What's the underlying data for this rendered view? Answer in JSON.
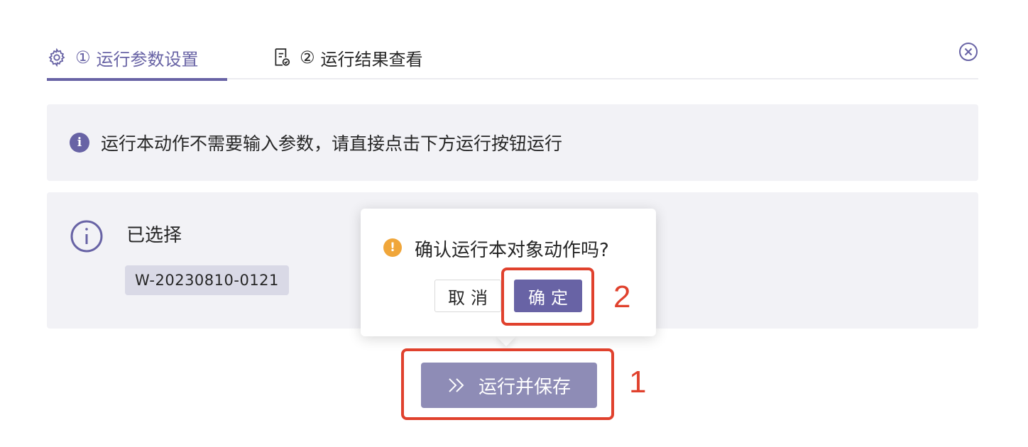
{
  "tabs": [
    {
      "step": "①",
      "label": "运行参数设置",
      "icon": "gear-icon",
      "active": true
    },
    {
      "step": "②",
      "label": "运行结果查看",
      "icon": "report-check-icon",
      "active": false
    }
  ],
  "info_banner": {
    "icon": "info-icon",
    "text": "运行本动作不需要输入参数，请直接点击下方运行按钮运行"
  },
  "selected_panel": {
    "icon": "info-outline-icon",
    "title": "已选择",
    "tag": "W-20230810-0121"
  },
  "run_button": {
    "icon": "double-chevron-right-icon",
    "label": "运行并保存"
  },
  "popconfirm": {
    "icon": "warning-icon",
    "message": "确认运行本对象动作吗?",
    "cancel_label": "取消",
    "ok_label": "确定"
  },
  "annotations": [
    {
      "number": "1",
      "target": "run_button"
    },
    {
      "number": "2",
      "target": "popconfirm.ok"
    }
  ],
  "colors": {
    "primary": "#6863a5",
    "primary_disabled": "#8e8cb6",
    "panel_bg": "#f2f2f6",
    "tag_bg": "#d9d9e6",
    "warning": "#f0a63a",
    "annotation": "#e0412d"
  }
}
